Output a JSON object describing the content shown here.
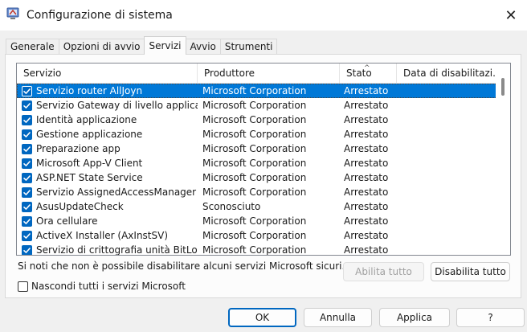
{
  "window": {
    "title": "Configurazione di sistema",
    "close_label": "✕"
  },
  "tabs": [
    {
      "label": "Generale",
      "active": false
    },
    {
      "label": "Opzioni di avvio",
      "active": false
    },
    {
      "label": "Servizi",
      "active": true
    },
    {
      "label": "Avvio",
      "active": false
    },
    {
      "label": "Strumenti",
      "active": false
    }
  ],
  "services": {
    "columns": [
      "Servizio",
      "Produttore",
      "Stato",
      "Data di disabilitazi..."
    ],
    "sort_icon": "^",
    "rows": [
      {
        "name": "Servizio router AllJoyn",
        "vendor": "Microsoft Corporation",
        "status": "Arrestato",
        "disabled_date": "",
        "checked": true,
        "selected": true
      },
      {
        "name": "Servizio Gateway di livello applicazi...",
        "vendor": "Microsoft Corporation",
        "status": "Arrestato",
        "disabled_date": "",
        "checked": true,
        "selected": false
      },
      {
        "name": "Identità applicazione",
        "vendor": "Microsoft Corporation",
        "status": "Arrestato",
        "disabled_date": "",
        "checked": true,
        "selected": false
      },
      {
        "name": "Gestione applicazione",
        "vendor": "Microsoft Corporation",
        "status": "Arrestato",
        "disabled_date": "",
        "checked": true,
        "selected": false
      },
      {
        "name": "Preparazione app",
        "vendor": "Microsoft Corporation",
        "status": "Arrestato",
        "disabled_date": "",
        "checked": true,
        "selected": false
      },
      {
        "name": "Microsoft App-V Client",
        "vendor": "Microsoft Corporation",
        "status": "Arrestato",
        "disabled_date": "",
        "checked": true,
        "selected": false
      },
      {
        "name": "ASP.NET State Service",
        "vendor": "Microsoft Corporation",
        "status": "Arrestato",
        "disabled_date": "",
        "checked": true,
        "selected": false
      },
      {
        "name": "Servizio AssignedAccessManager",
        "vendor": "Microsoft Corporation",
        "status": "Arrestato",
        "disabled_date": "",
        "checked": true,
        "selected": false
      },
      {
        "name": "AsusUpdateCheck",
        "vendor": "Sconosciuto",
        "status": "Arrestato",
        "disabled_date": "",
        "checked": true,
        "selected": false
      },
      {
        "name": "Ora cellulare",
        "vendor": "Microsoft Corporation",
        "status": "Arrestato",
        "disabled_date": "",
        "checked": true,
        "selected": false
      },
      {
        "name": "ActiveX Installer (AxInstSV)",
        "vendor": "Microsoft Corporation",
        "status": "Arrestato",
        "disabled_date": "",
        "checked": true,
        "selected": false
      },
      {
        "name": "Servizio di crittografia unità BitLocker",
        "vendor": "Microsoft Corporation",
        "status": "Arrestato",
        "disabled_date": "",
        "checked": true,
        "selected": false
      }
    ]
  },
  "note": "Si noti che non è possibile disabilitare alcuni servizi Microsoft sicuri.",
  "enable_all_label": "Abilita tutto",
  "disable_all_label": "Disabilita tutto",
  "hide_ms_label": "Nascondi tutti i servizi Microsoft",
  "footer": {
    "ok": "OK",
    "cancel": "Annulla",
    "apply": "Applica",
    "help": "?"
  },
  "colors": {
    "accent": "#0067c0",
    "selection": "#0078d7"
  }
}
